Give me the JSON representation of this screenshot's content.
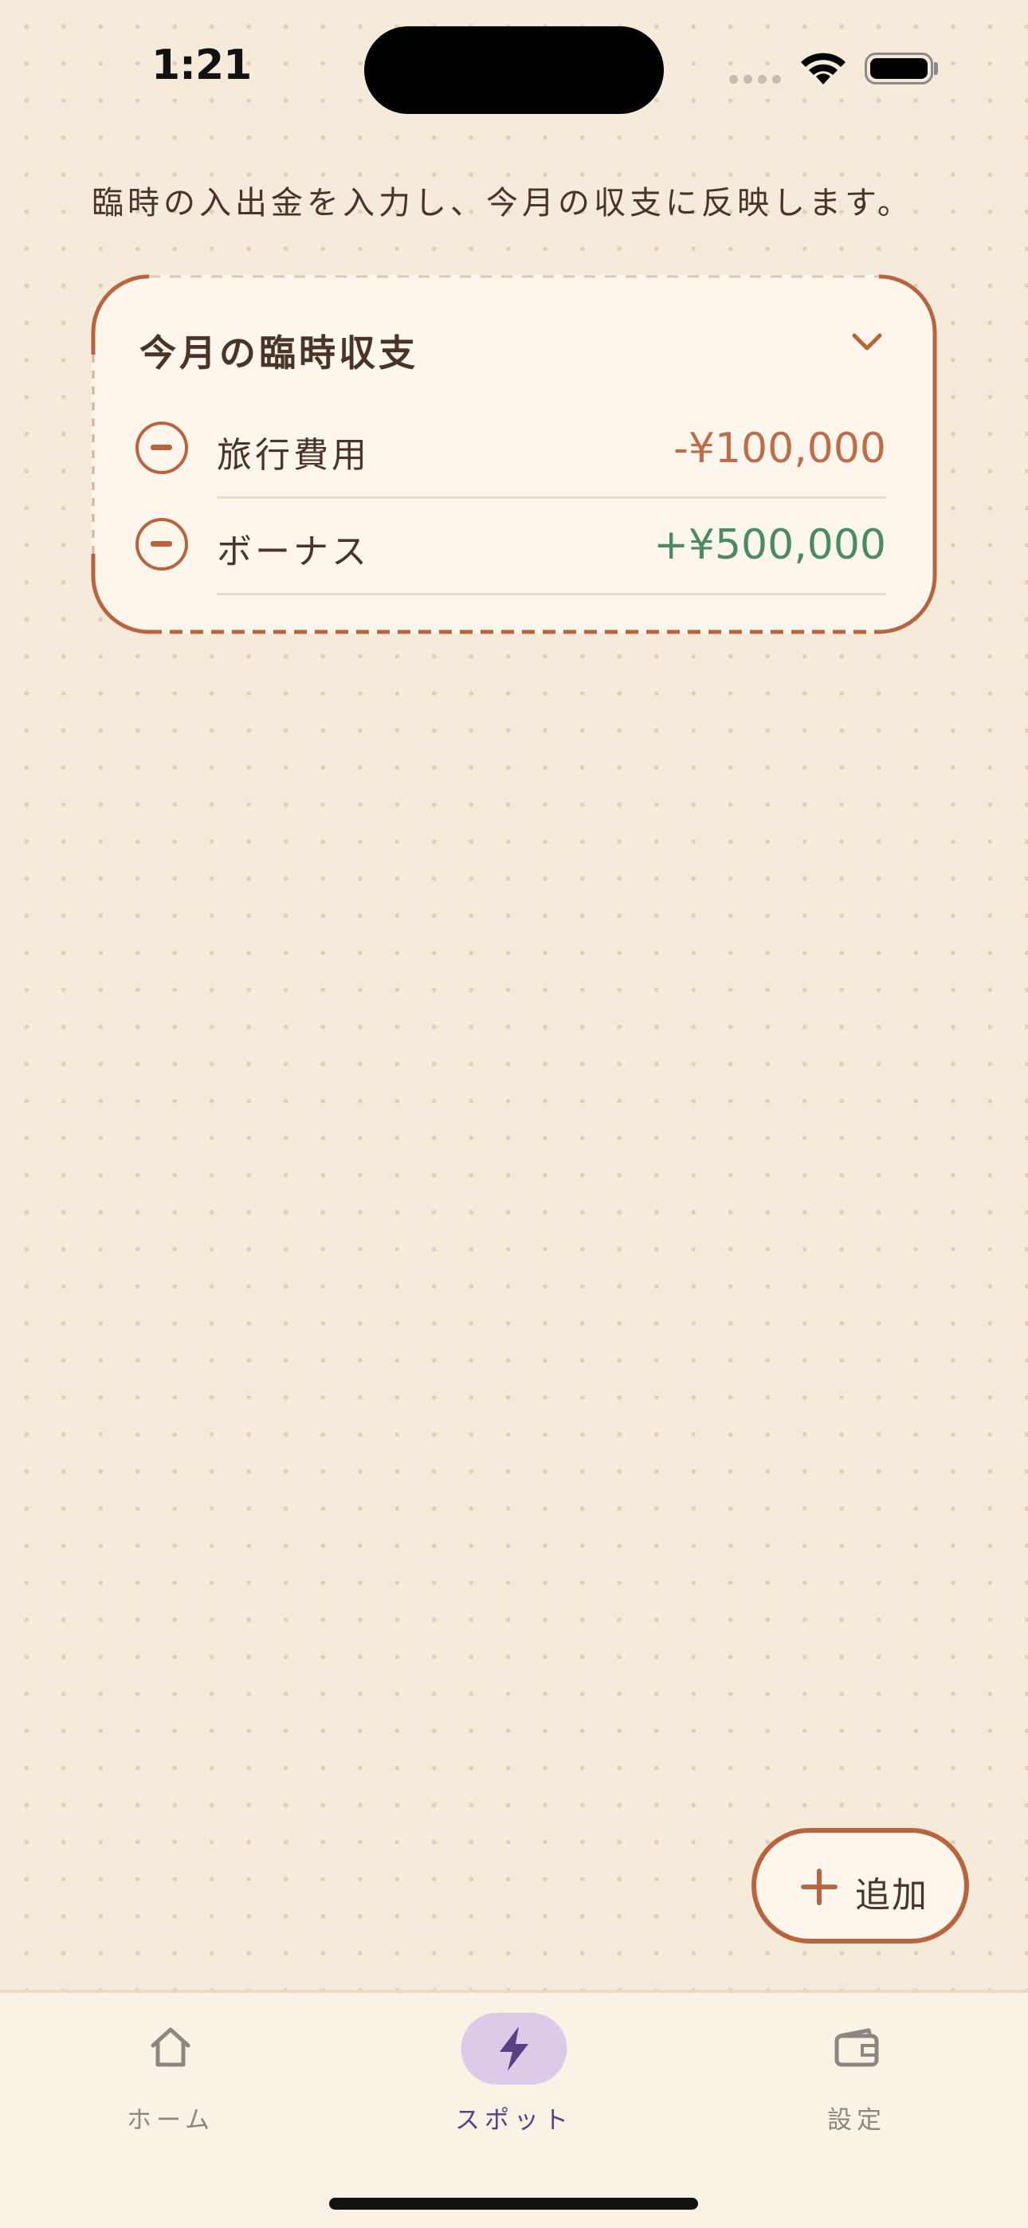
{
  "status_bar": {
    "time": "1:21"
  },
  "description": "臨時の入出金を入力し、今月の収支に反映します。",
  "card": {
    "title": "今月の臨時収支",
    "entries": [
      {
        "name": "旅行費用",
        "amount": "-¥100,000",
        "type": "expense"
      },
      {
        "name": "ボーナス",
        "amount": "+¥500,000",
        "type": "income"
      }
    ]
  },
  "fab": {
    "label": "追加",
    "icon": "plus-icon"
  },
  "tabbar": {
    "tabs": [
      {
        "label": "ホーム",
        "icon": "home-icon",
        "active": false
      },
      {
        "label": "スポット",
        "icon": "bolt-icon",
        "active": true
      },
      {
        "label": "設定",
        "icon": "wallet-icon",
        "active": false
      }
    ]
  },
  "colors": {
    "background": "#f6eadb",
    "accent": "#b8653f",
    "expense": "#bd6d49",
    "income": "#4c8a60",
    "active_tab": "#5a3f86",
    "active_tab_pill": "#dbcbe8"
  }
}
